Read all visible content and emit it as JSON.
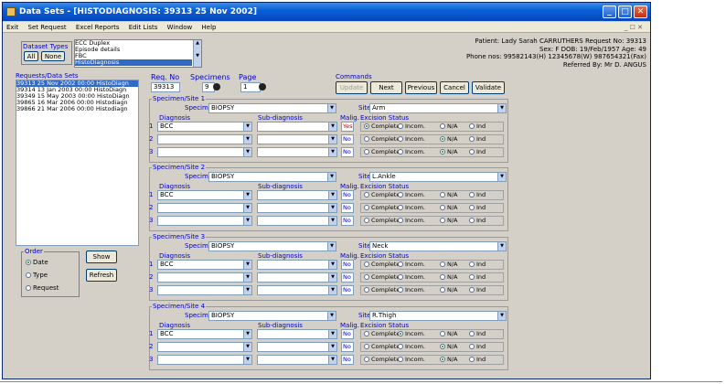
{
  "window": {
    "title": "Data Sets - [HISTODIAGNOSIS: 39313   25 Nov 2002]"
  },
  "menu": {
    "items": [
      "Exit",
      "Set Request",
      "Excel Reports",
      "Edit Lists",
      "Window",
      "Help"
    ],
    "mdi_controls": "_ ☐ ✕"
  },
  "dataset_types": {
    "label": "Dataset Types",
    "all_label": "All",
    "none_label": "None",
    "items": [
      "ECC Duplex",
      "Episode details",
      "FBC",
      "HistoDiagnosis"
    ]
  },
  "patient": {
    "line1": "Patient: Lady Sarah CARRUTHERS    Request No: 39313",
    "line2": "Sex: F DOB: 19/Feb/1957 Age: 49",
    "line3": "Phone nos: 99582143(H) 12345678(W) 987654321(Fax)",
    "line4": "Referred By: Mr D. ANGUS"
  },
  "requests": {
    "label": "Requests/Data Sets",
    "items": [
      "39313  25 Nov 2002 00:00 HistoDiagn",
      "39314  13 Jan 2003 00:00 HistoDiagn",
      "39349  15 May 2003 00:00 HistoDiagn",
      "39865  16 Mar 2006 00:00 Histodiagn",
      "39866  21 Mar 2006 00:00 Histodiagn"
    ]
  },
  "order": {
    "label": "Order",
    "options": [
      "Date",
      "Type",
      "Request"
    ],
    "selected": "Date"
  },
  "show_label": "Show",
  "refresh_label": "Refresh",
  "header": {
    "req_no_label": "Req. No",
    "req_no_value": "39313",
    "specimens_label": "Specimens",
    "specimens_value": "9",
    "page_label": "Page",
    "page_value": "1"
  },
  "commands": {
    "label": "Commands",
    "update": "Update",
    "next": "Next",
    "previous": "Previous",
    "cancel": "Cancel",
    "validate": "Validate"
  },
  "field_labels": {
    "specimen": "Specimen",
    "site": "Site",
    "diagnosis": "Diagnosis",
    "subdiagnosis": "Sub-diagnosis",
    "malig": "Malig.",
    "excision": "Excision Status"
  },
  "excision_options": [
    "Complete",
    "Incom.",
    "N/A",
    "Ind"
  ],
  "sites": [
    {
      "title": "Specimen/Site 1",
      "specimen": "BIOPSY",
      "site": "Arm",
      "rows": [
        {
          "n": "1",
          "diagnosis": "BCC",
          "sub": "",
          "malig": "Yes",
          "excision": "Complete"
        },
        {
          "n": "2",
          "diagnosis": "",
          "sub": "",
          "malig": "No",
          "excision": "N/A"
        },
        {
          "n": "3",
          "diagnosis": "",
          "sub": "",
          "malig": "No",
          "excision": "N/A"
        }
      ]
    },
    {
      "title": "Specimen/Site 2",
      "specimen": "BIOPSY",
      "site": "L.Ankle",
      "rows": [
        {
          "n": "1",
          "diagnosis": "BCC",
          "sub": "",
          "malig": "No",
          "excision": ""
        },
        {
          "n": "2",
          "diagnosis": "",
          "sub": "",
          "malig": "No",
          "excision": ""
        },
        {
          "n": "3",
          "diagnosis": "",
          "sub": "",
          "malig": "No",
          "excision": ""
        }
      ]
    },
    {
      "title": "Specimen/Site 3",
      "specimen": "BIOPSY",
      "site": "Neck",
      "rows": [
        {
          "n": "1",
          "diagnosis": "BCC",
          "sub": "",
          "malig": "No",
          "excision": ""
        },
        {
          "n": "2",
          "diagnosis": "",
          "sub": "",
          "malig": "No",
          "excision": ""
        },
        {
          "n": "3",
          "diagnosis": "",
          "sub": "",
          "malig": "No",
          "excision": ""
        }
      ]
    },
    {
      "title": "Specimen/Site 4",
      "specimen": "BIOPSY",
      "site": "R.Thigh",
      "rows": [
        {
          "n": "1",
          "diagnosis": "BCC",
          "sub": "",
          "malig": "No",
          "excision": "Incom."
        },
        {
          "n": "2",
          "diagnosis": "",
          "sub": "",
          "malig": "No",
          "excision": "N/A"
        },
        {
          "n": "3",
          "diagnosis": "",
          "sub": "",
          "malig": "No",
          "excision": "N/A"
        }
      ]
    }
  ],
  "colors": {
    "title_bar": "#0a5fd6",
    "selection": "#316ac5",
    "label_blue": "#0000cc",
    "malig_yes": "#cc0000"
  }
}
